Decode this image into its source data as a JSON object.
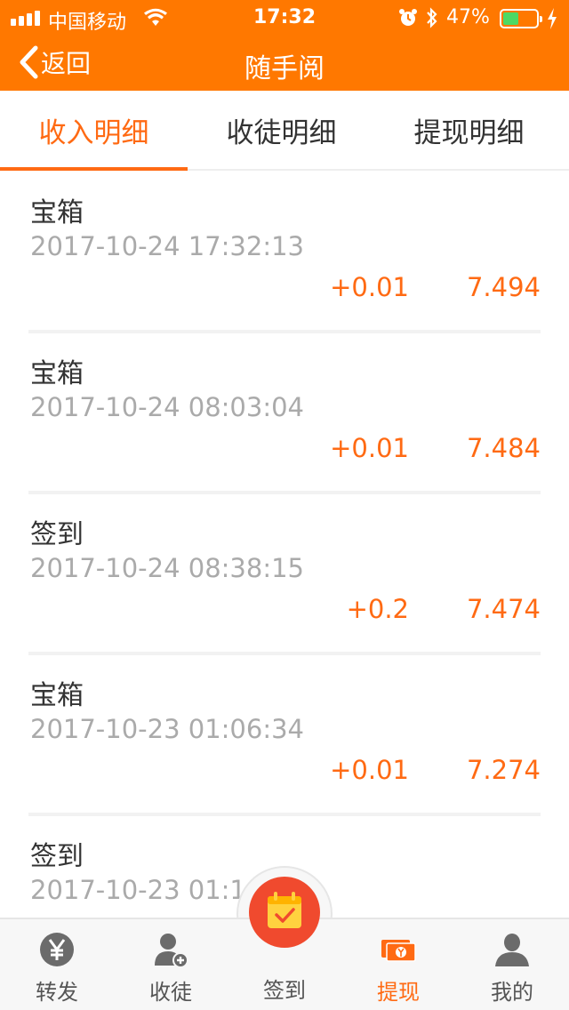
{
  "status_bar": {
    "carrier": "中国移动",
    "time": "17:32",
    "battery_pct": "47%",
    "battery_level": 0.47
  },
  "nav": {
    "back_label": "返回",
    "title": "随手阅"
  },
  "tabs": [
    {
      "label": "收入明细",
      "active": true
    },
    {
      "label": "收徒明细",
      "active": false
    },
    {
      "label": "提现明细",
      "active": false
    }
  ],
  "records": [
    {
      "title": "宝箱",
      "time": "2017-10-24 17:32:13",
      "amount": "+0.01",
      "balance": "7.494"
    },
    {
      "title": "宝箱",
      "time": "2017-10-24 08:03:04",
      "amount": "+0.01",
      "balance": "7.484"
    },
    {
      "title": "签到",
      "time": "2017-10-24 08:38:15",
      "amount": "+0.2",
      "balance": "7.474"
    },
    {
      "title": "宝箱",
      "time": "2017-10-23 01:06:34",
      "amount": "+0.01",
      "balance": "7.274"
    },
    {
      "title": "签到",
      "time": "2017-10-23 01:14",
      "amount": "",
      "balance": ""
    }
  ],
  "tabbar": {
    "items": [
      {
        "label": "转发",
        "icon": "yen-coin-icon"
      },
      {
        "label": "收徒",
        "icon": "add-user-icon"
      },
      {
        "label": "签到",
        "icon": "calendar-check-icon"
      },
      {
        "label": "提现",
        "icon": "cash-icon"
      },
      {
        "label": "我的",
        "icon": "person-icon"
      }
    ]
  },
  "colors": {
    "brand": "#ff7800",
    "accent": "#ff6a13",
    "checkin": "#f04a2e"
  }
}
